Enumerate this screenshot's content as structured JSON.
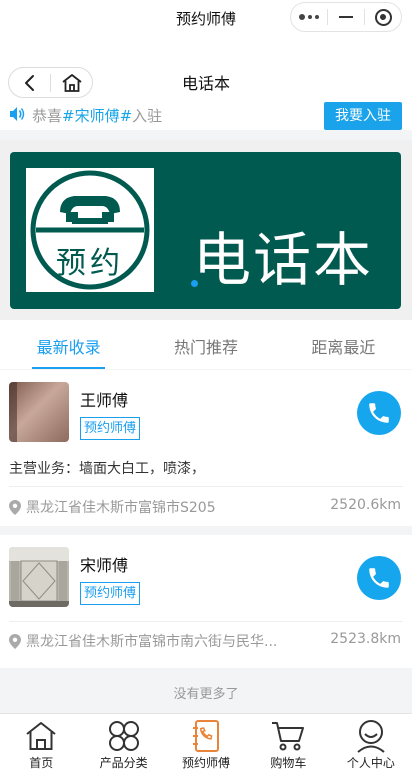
{
  "window": {
    "title": "预约师傅"
  },
  "navbar": {
    "title": "电话本"
  },
  "notice": {
    "prefix": "恭喜",
    "highlight": "#宋师傅#",
    "suffix": "入驻",
    "join_label": "我要入驻"
  },
  "banner": {
    "logo_text": "预约",
    "big_text": "电话本"
  },
  "tabs": [
    {
      "label": "最新收录",
      "active": true
    },
    {
      "label": "热门推荐",
      "active": false
    },
    {
      "label": "距离最近",
      "active": false
    }
  ],
  "listings": [
    {
      "name": "王师傅",
      "tag": "预约师傅",
      "business_label": "主营业务：",
      "business": "墙面大白工，喷漆，",
      "address": "黑龙江省佳木斯市富锦市S205",
      "distance": "2520.6km"
    },
    {
      "name": "宋师傅",
      "tag": "预约师傅",
      "address": "黑龙江省佳木斯市富锦市南六街与民华...",
      "distance": "2523.8km"
    }
  ],
  "footer": {
    "no_more": "没有更多了"
  },
  "tabbar": [
    {
      "label": "首页",
      "icon": "home-icon"
    },
    {
      "label": "产品分类",
      "icon": "category-icon"
    },
    {
      "label": "预约师傅",
      "icon": "phonebook-icon",
      "active": true
    },
    {
      "label": "购物车",
      "icon": "cart-icon"
    },
    {
      "label": "个人中心",
      "icon": "user-icon"
    }
  ],
  "colors": {
    "accent": "#1a9ff0",
    "banner": "#005a4f",
    "tab_active_icon": "#e8853a"
  }
}
